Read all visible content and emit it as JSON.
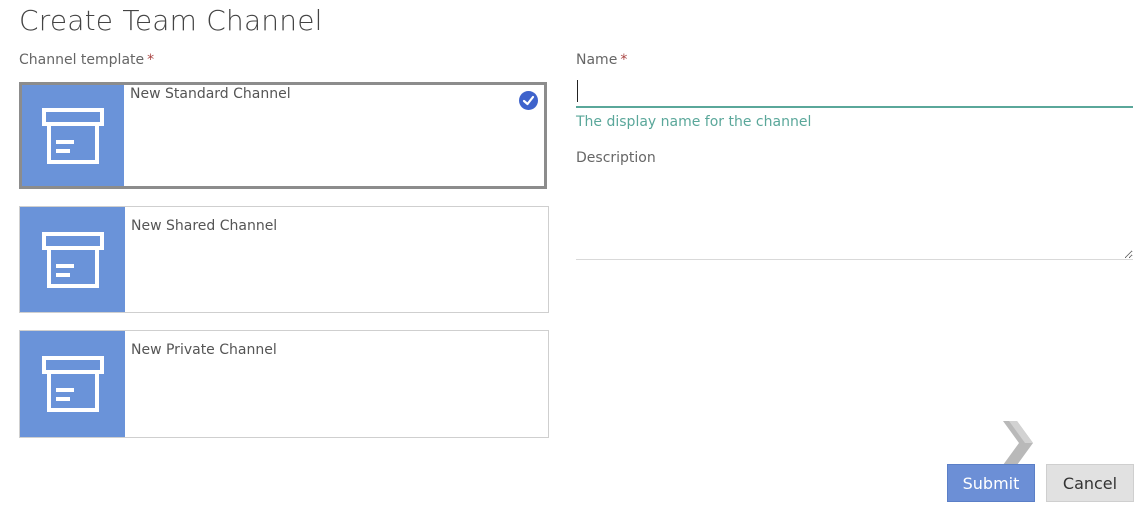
{
  "page": {
    "title": "Create Team Channel"
  },
  "channel_template": {
    "label": "Channel template",
    "required_mark": "*",
    "options": [
      {
        "label": "New Standard Channel",
        "selected": true,
        "icon": "archive-box-icon"
      },
      {
        "label": "New Shared Channel",
        "selected": false,
        "icon": "archive-box-icon"
      },
      {
        "label": "New Private Channel",
        "selected": false,
        "icon": "archive-box-icon"
      }
    ],
    "thumb_color": "#6a93d9"
  },
  "name": {
    "label": "Name",
    "required_mark": "*",
    "value": "",
    "help_text": "The display name for the channel"
  },
  "description": {
    "label": "Description",
    "value": ""
  },
  "actions": {
    "submit_label": "Submit",
    "cancel_label": "Cancel"
  },
  "colors": {
    "accent": "#3e63cc",
    "focus": "#5aa79a",
    "submit_bg": "#6c8fd6"
  }
}
